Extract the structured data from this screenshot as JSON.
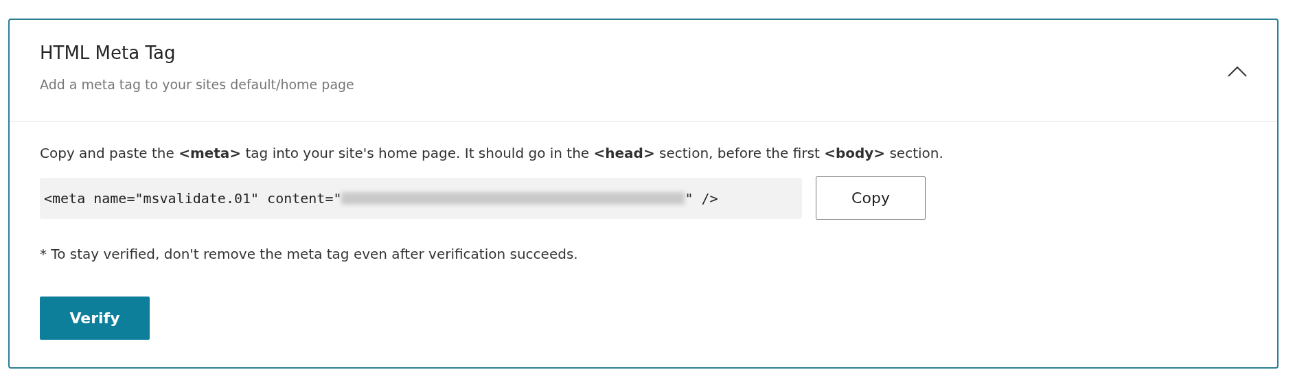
{
  "panel": {
    "title": "HTML Meta Tag",
    "subtitle": "Add a meta tag to your sites default/home page",
    "expanded": true
  },
  "instructions": "Copy and paste the **<meta>** tag into your site's home page. It should go in the **<head>** section, before the first **<body>** section.",
  "code": {
    "before": "<meta name=\"msvalidate.01\" content=\"",
    "after": "\" />",
    "redacted": true
  },
  "copy_button": "Copy",
  "note": "* To stay verified, don't remove the meta tag even after verification succeeds.",
  "verify_button": "Verify"
}
